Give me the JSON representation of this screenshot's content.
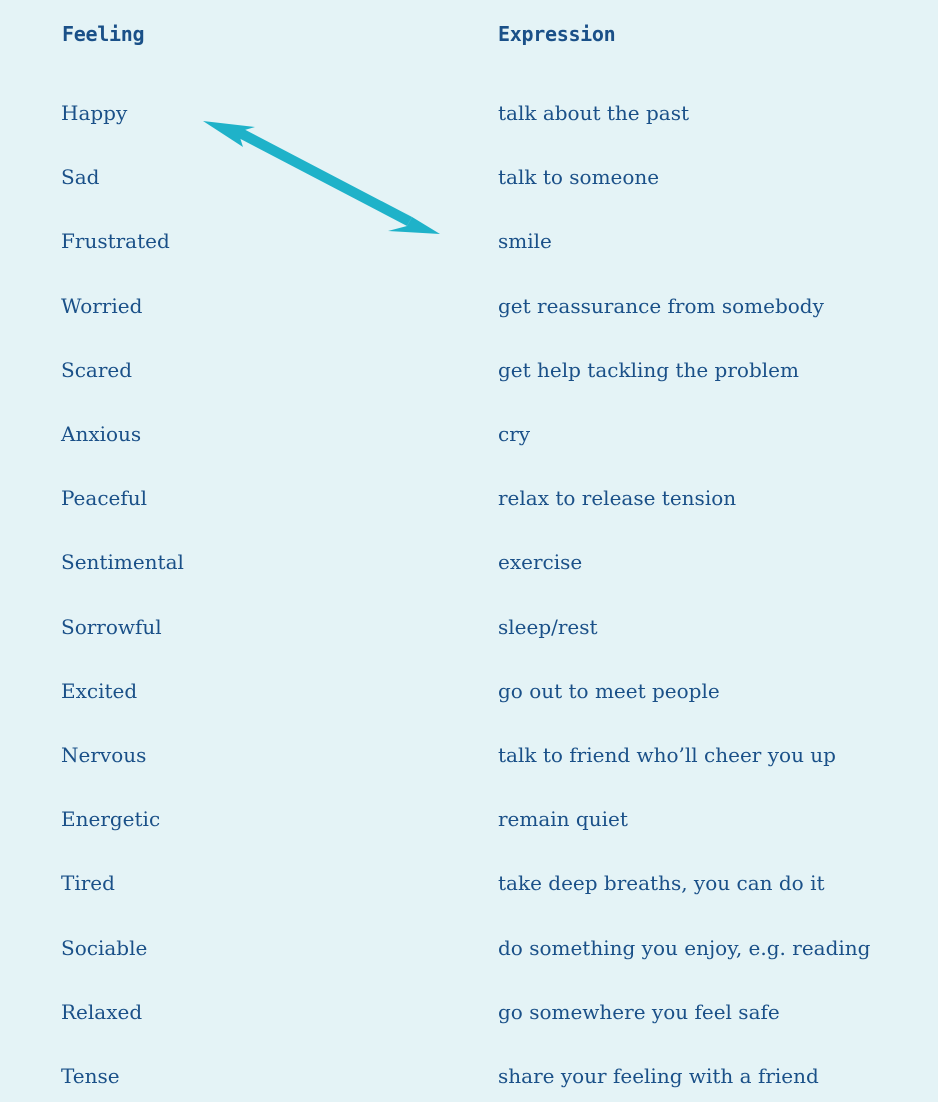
{
  "headers": {
    "feeling": "Feeling",
    "expression": "Expression"
  },
  "feelings": [
    "Happy",
    "Sad",
    "Frustrated",
    "Worried",
    "Scared",
    "Anxious",
    "Peaceful",
    "Sentimental",
    "Sorrowful",
    "Excited",
    "Nervous",
    "Energetic",
    "Tired",
    "Sociable",
    "Relaxed",
    "Tense"
  ],
  "expressions": [
    "talk about the past",
    "talk to someone",
    "smile",
    "get reassurance from somebody",
    "get help tackling the problem",
    "cry",
    "relax to release tension",
    "exercise",
    "sleep/rest",
    "go out to meet people",
    "talk to friend who’ll cheer you up",
    "remain quiet",
    "take deep breaths, you can do it",
    "do something you enjoy, e.g. reading",
    "go somewhere you feel safe",
    "share your feeling with a friend"
  ],
  "colors": {
    "background": "#e4f3f6",
    "text": "#1a5088",
    "arrow": "#1fb2c9"
  },
  "icons": {
    "arrow": "double-headed-arrow-icon"
  }
}
